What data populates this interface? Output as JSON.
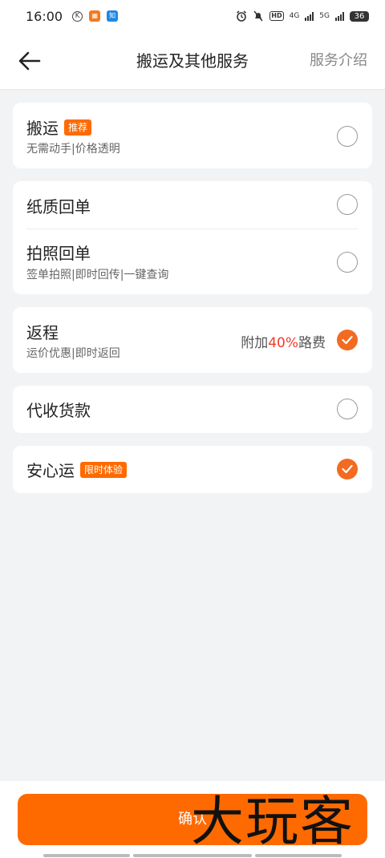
{
  "status_bar": {
    "time": "16:00",
    "left_icons": [
      "k-circle-icon",
      "taobao-app-icon",
      "zhihu-app-icon"
    ],
    "zhihu_label": "知乎",
    "battery": "36",
    "network_a": "4G",
    "network_b": "5G",
    "hd_label": "HD"
  },
  "nav": {
    "title": "搬运及其他服务",
    "right_link": "服务介绍"
  },
  "services": {
    "moving": {
      "title": "搬运",
      "tag": "推荐",
      "subtitle": "无需动手|价格透明",
      "checked": false
    },
    "paper_receipt": {
      "title": "纸质回单",
      "checked": false
    },
    "photo_receipt": {
      "title": "拍照回单",
      "subtitle": "签单拍照|即时回传|一键查询",
      "checked": false
    },
    "return_trip": {
      "title": "返程",
      "subtitle": "运价优惠|即时返回",
      "extra_prefix": "附加",
      "extra_percent": "40%",
      "extra_suffix": "路费",
      "checked": true
    },
    "cod": {
      "title": "代收货款",
      "checked": false
    },
    "secure": {
      "title": "安心运",
      "tag": "限时体验",
      "checked": true
    }
  },
  "colors": {
    "accent": "#ff6a00",
    "check": "#f26b21",
    "highlight": "#ef3b2d",
    "background": "#f2f3f5"
  },
  "footer": {
    "confirm_label": "确认",
    "watermark": "大玩客"
  }
}
